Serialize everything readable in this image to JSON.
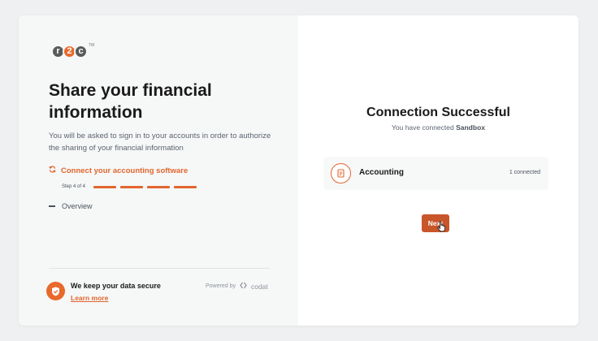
{
  "brand": {
    "logo_letters": [
      "r",
      "2",
      "c"
    ],
    "logo_tm": "TM",
    "accent_color": "#e1662e"
  },
  "left_panel": {
    "title": "Share your financial information",
    "subtitle": "You will be asked to sign in to your accounts in order to authorize the sharing of your financial information",
    "active_step": {
      "icon": "refresh-icon",
      "label": "Connect your accounting software"
    },
    "progress": {
      "label": "Step 4 of 4",
      "current": 4,
      "total": 4
    },
    "overview_label": "Overview",
    "security": {
      "icon": "shield-check-icon",
      "title": "We keep your data secure",
      "link_label": "Learn more"
    },
    "powered_by": {
      "label": "Powered by",
      "vendor": "codat"
    }
  },
  "right_panel": {
    "title": "Connection Successful",
    "subtitle_prefix": "You have connected",
    "subtitle_company": "Sandbox",
    "integration": {
      "icon": "document-icon",
      "label": "Accounting",
      "status": "1 connected"
    },
    "next_label": "Next"
  }
}
